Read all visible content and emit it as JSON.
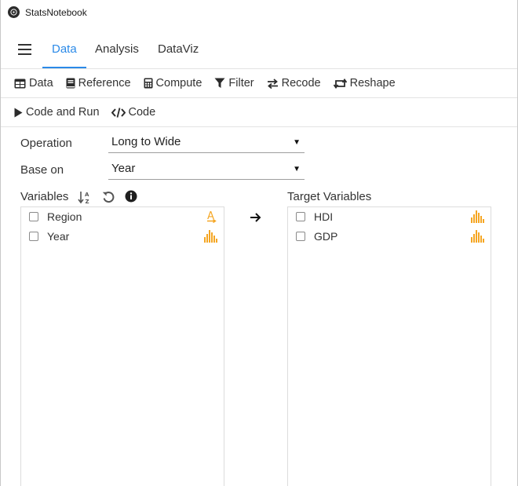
{
  "window": {
    "title": "StatsNotebook"
  },
  "tabs": [
    {
      "label": "Data",
      "active": true
    },
    {
      "label": "Analysis",
      "active": false
    },
    {
      "label": "DataViz",
      "active": false
    }
  ],
  "toolbar": {
    "data": "Data",
    "reference": "Reference",
    "compute": "Compute",
    "filter": "Filter",
    "recode": "Recode",
    "reshape": "Reshape"
  },
  "actions": {
    "code_and_run": "Code and Run",
    "code": "Code"
  },
  "form": {
    "operation_label": "Operation",
    "operation_value": "Long to Wide",
    "base_on_label": "Base on",
    "base_on_value": "Year"
  },
  "variables": {
    "label": "Variables",
    "items": [
      {
        "name": "Region",
        "type": "string-icon"
      },
      {
        "name": "Year",
        "type": "numeric-icon"
      }
    ]
  },
  "target": {
    "label": "Target Variables",
    "items": [
      {
        "name": "HDI",
        "type": "numeric-icon"
      },
      {
        "name": "GDP",
        "type": "numeric-icon"
      }
    ]
  },
  "colors": {
    "accent": "#2b8ae8",
    "type_icon": "#f5a623"
  }
}
